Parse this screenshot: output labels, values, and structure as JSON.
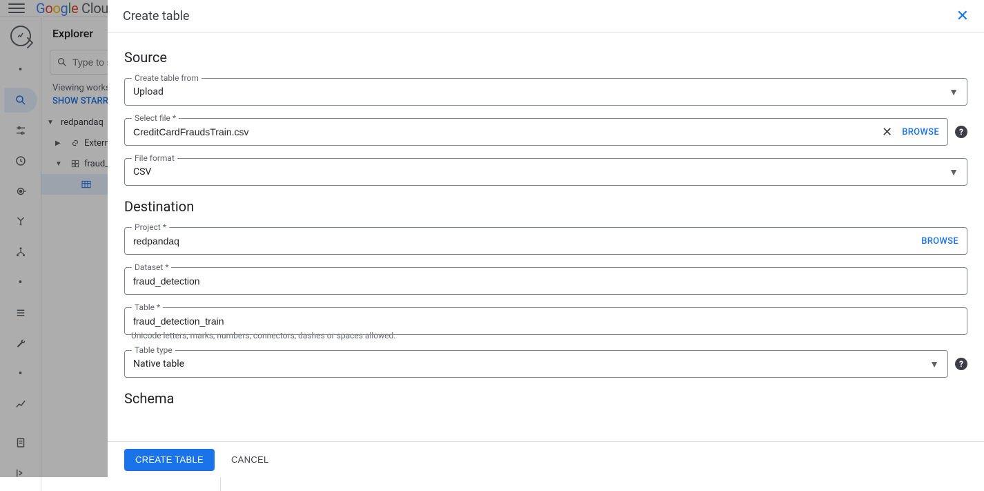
{
  "header": {
    "logo_text": "Google Cloud"
  },
  "explorer": {
    "title": "Explorer",
    "search_placeholder": "Type to search",
    "viewing_text": "Viewing workspace resources.",
    "show_starred": "SHOW STARRED ONLY",
    "project": "redpandaq",
    "external": "External connections",
    "dataset": "fraud_detection"
  },
  "drawer": {
    "title": "Create table",
    "source": {
      "heading": "Source",
      "create_from_label": "Create table from",
      "create_from_value": "Upload",
      "select_file_label": "Select file *",
      "select_file_value": "CreditCardFraudsTrain.csv",
      "browse": "BROWSE",
      "file_format_label": "File format",
      "file_format_value": "CSV"
    },
    "destination": {
      "heading": "Destination",
      "project_label": "Project *",
      "project_value": "redpandaq",
      "browse": "BROWSE",
      "dataset_label": "Dataset *",
      "dataset_value": "fraud_detection",
      "table_label": "Table *",
      "table_value": "fraud_detection_train",
      "table_helper": "Unicode letters, marks, numbers, connectors, dashes or spaces allowed.",
      "table_type_label": "Table type",
      "table_type_value": "Native table"
    },
    "schema": {
      "heading": "Schema"
    },
    "footer": {
      "create": "CREATE TABLE",
      "cancel": "CANCEL"
    }
  }
}
